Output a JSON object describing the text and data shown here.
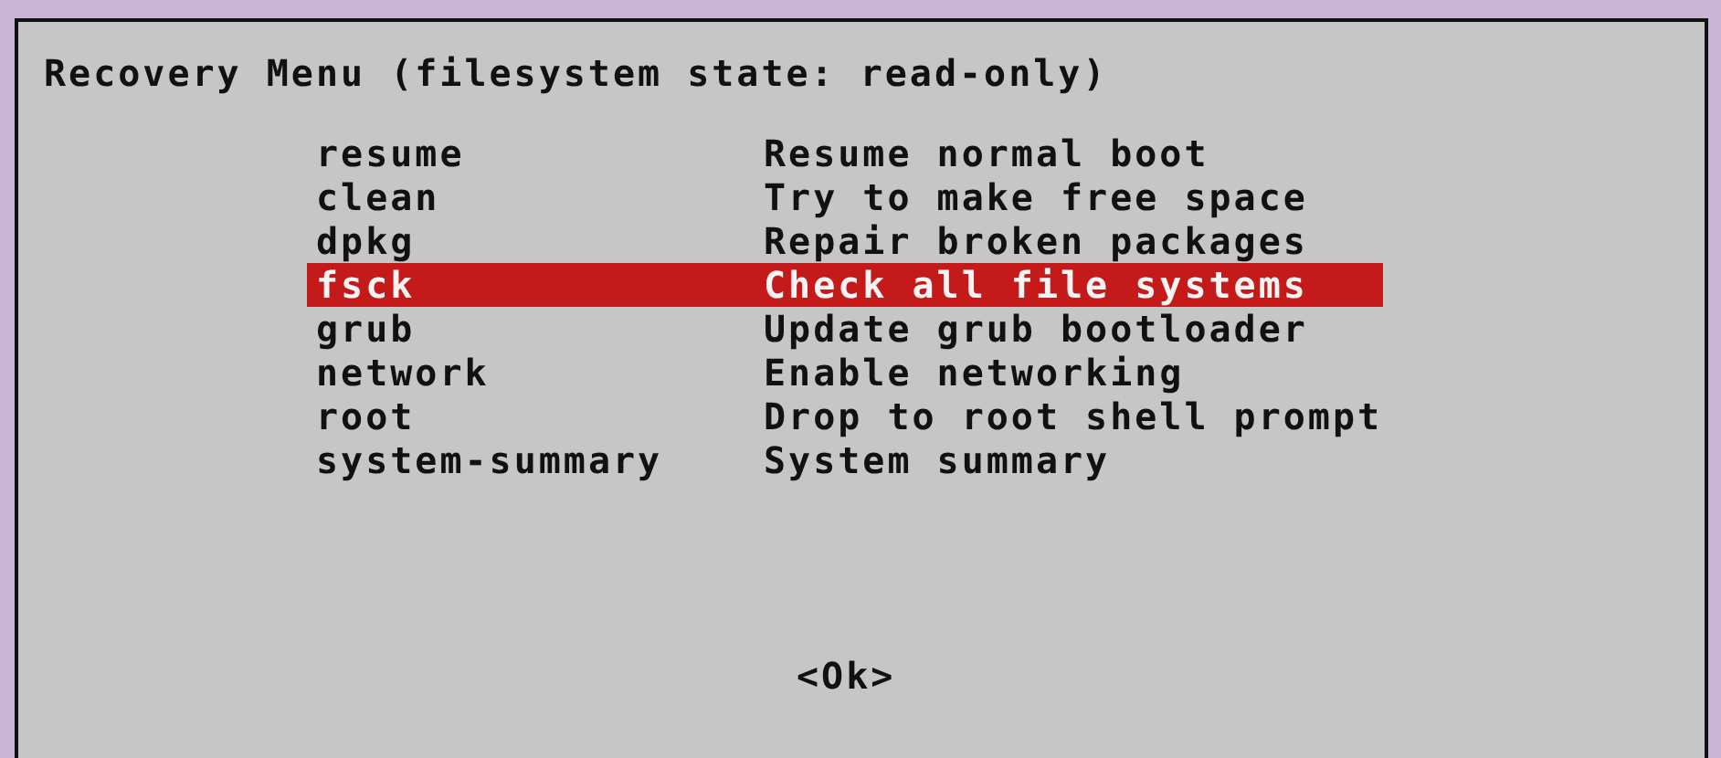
{
  "dialog": {
    "title": "Recovery Menu (filesystem state: read-only)"
  },
  "menu_items": [
    {
      "name": "resume",
      "description": "Resume normal boot",
      "selected": false
    },
    {
      "name": "clean",
      "description": "Try to make free space",
      "selected": false
    },
    {
      "name": "dpkg",
      "description": "Repair broken packages",
      "selected": false
    },
    {
      "name": "fsck",
      "description": "Check all file systems",
      "selected": true
    },
    {
      "name": "grub",
      "description": "Update grub bootloader",
      "selected": false
    },
    {
      "name": "network",
      "description": "Enable networking",
      "selected": false
    },
    {
      "name": "root",
      "description": "Drop to root shell prompt",
      "selected": false
    },
    {
      "name": "system-summary",
      "description": "System summary",
      "selected": false
    }
  ],
  "ok_button": {
    "label": "<Ok>",
    "selected": false
  }
}
